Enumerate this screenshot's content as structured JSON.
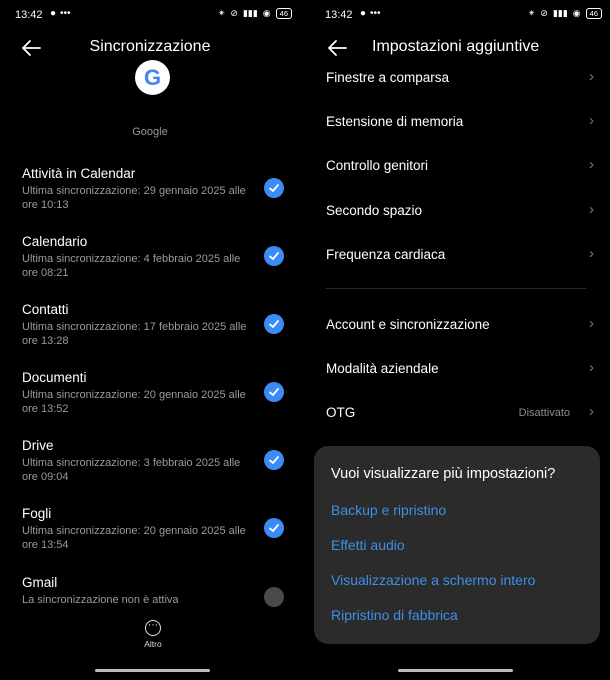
{
  "status_bar": {
    "time": "13:42",
    "battery": "46"
  },
  "left": {
    "title": "Sincronizzazione",
    "account": "Google",
    "items": [
      {
        "name": "Attività in Calendar",
        "sub": "Ultima sincronizzazione: 29 gennaio 2025 alle ore 10:13",
        "checked": true
      },
      {
        "name": "Calendario",
        "sub": "Ultima sincronizzazione: 4 febbraio 2025 alle ore 08:21",
        "checked": true
      },
      {
        "name": "Contatti",
        "sub": "Ultima sincronizzazione: 17 febbraio 2025 alle ore 13:28",
        "checked": true
      },
      {
        "name": "Documenti",
        "sub": "Ultima sincronizzazione: 20 gennaio 2025 alle ore 13:52",
        "checked": true
      },
      {
        "name": "Drive",
        "sub": "Ultima sincronizzazione: 3 febbraio 2025 alle ore 09:04",
        "checked": true
      },
      {
        "name": "Fogli",
        "sub": "Ultima sincronizzazione: 20 gennaio 2025 alle ore 13:54",
        "checked": true
      },
      {
        "name": "Gmail",
        "sub": "La sincronizzazione non è attiva",
        "checked": false
      }
    ],
    "more_label": "Altro"
  },
  "right": {
    "title": "Impostazioni aggiuntive",
    "items": [
      {
        "label": "Finestre a comparsa",
        "value": ""
      },
      {
        "label": "Estensione di memoria",
        "value": ""
      },
      {
        "label": "Controllo genitori",
        "value": ""
      },
      {
        "label": "Secondo spazio",
        "value": ""
      },
      {
        "label": "Frequenza cardiaca",
        "value": ""
      },
      {
        "label": "Account e sincronizzazione",
        "value": ""
      },
      {
        "label": "Modalità aziendale",
        "value": ""
      },
      {
        "label": "OTG",
        "value": "Disattivato"
      }
    ],
    "popup": {
      "question": "Vuoi visualizzare più impostazioni?",
      "options": [
        "Backup e ripristino",
        "Effetti audio",
        "Visualizzazione a schermo intero",
        "Ripristino di fabbrica"
      ]
    }
  },
  "colors": {
    "accent": "#3a8bf6",
    "link": "#3f8fe8",
    "popup_bg": "#2b2b2b"
  }
}
